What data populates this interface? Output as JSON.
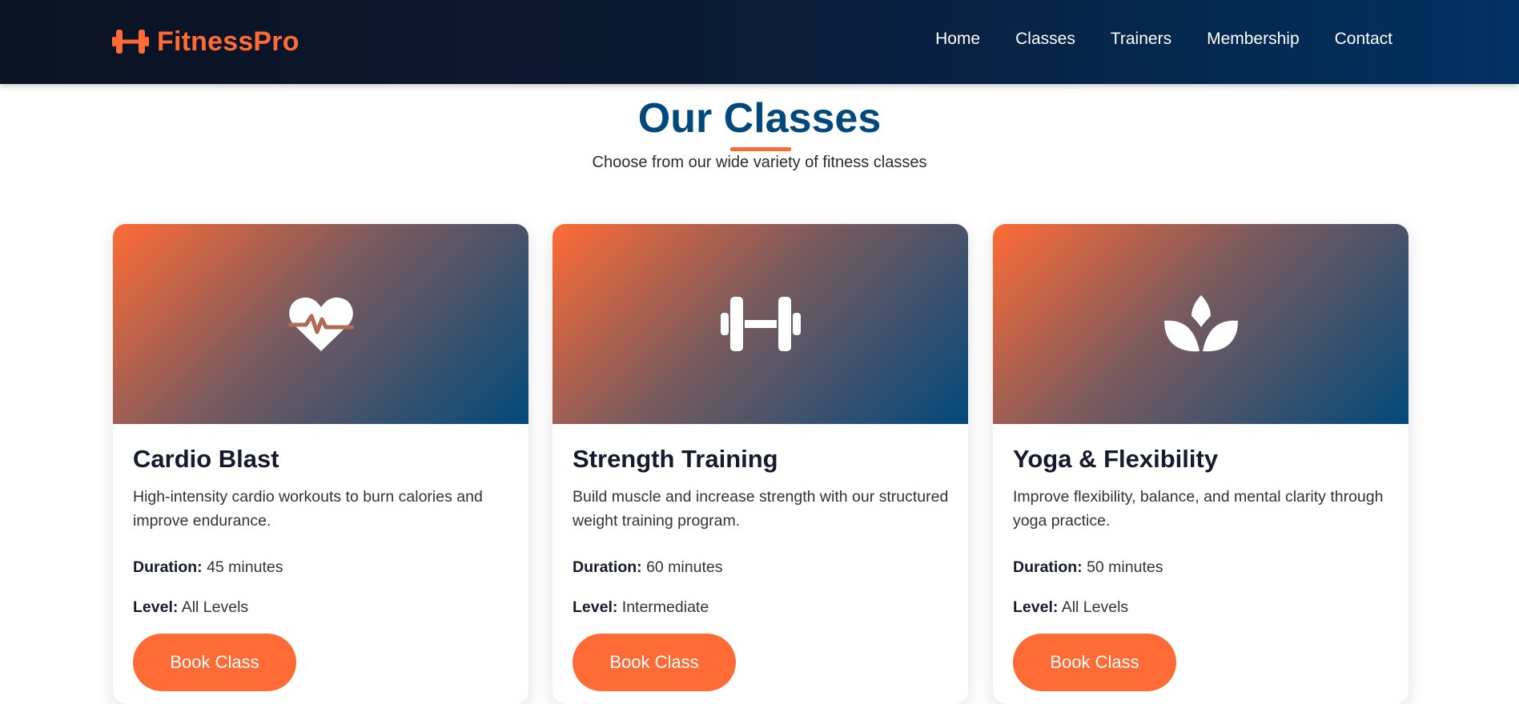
{
  "brand": {
    "name": "FitnessPro",
    "icon": "dumbbell-icon",
    "color": "#ff6b35"
  },
  "nav": {
    "links": [
      "Home",
      "Classes",
      "Trainers",
      "Membership",
      "Contact"
    ]
  },
  "section": {
    "title": "Our Classes",
    "subtitle": "Choose from our wide variety of fitness classes",
    "title_color": "#01497c",
    "accent_color": "#ff6b35"
  },
  "classes": [
    {
      "icon": "heart-pulse-icon",
      "title": "Cardio Blast",
      "description": "High-intensity cardio workouts to burn calories and improve endurance.",
      "duration_label": "Duration:",
      "duration": "45 minutes",
      "level_label": "Level:",
      "level": "All Levels",
      "button_label": "Book Class"
    },
    {
      "icon": "dumbbell-icon",
      "title": "Strength Training",
      "description": "Build muscle and increase strength with our structured weight training program.",
      "duration_label": "Duration:",
      "duration": "60 minutes",
      "level_label": "Level:",
      "level": "Intermediate",
      "button_label": "Book Class"
    },
    {
      "icon": "lotus-icon",
      "title": "Yoga & Flexibility",
      "description": "Improve flexibility, balance, and mental clarity through yoga practice.",
      "duration_label": "Duration:",
      "duration": "50 minutes",
      "level_label": "Level:",
      "level": "All Levels",
      "button_label": "Book Class"
    }
  ]
}
